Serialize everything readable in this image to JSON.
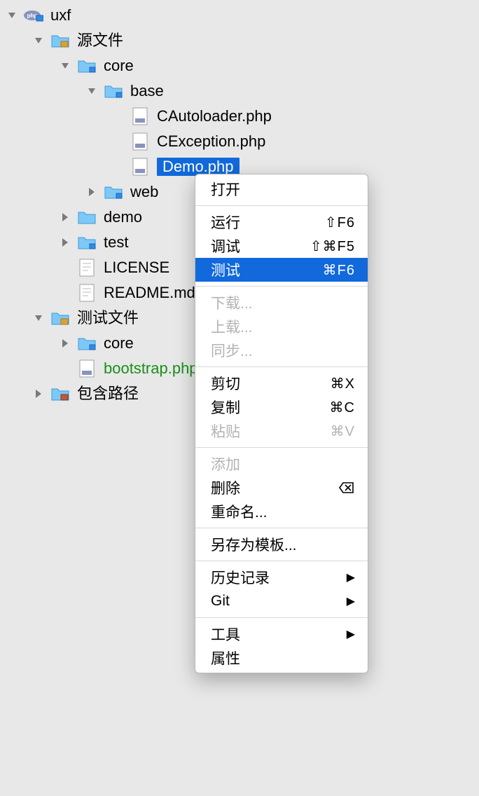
{
  "tree": {
    "root": {
      "label": "uxf"
    },
    "sources": {
      "label": "源文件"
    },
    "core": {
      "label": "core"
    },
    "base": {
      "label": "base"
    },
    "f_autoloader": {
      "label": "CAutoloader.php"
    },
    "f_exception": {
      "label": "CException.php"
    },
    "f_demo": {
      "label": "Demo.php"
    },
    "web": {
      "label": "web"
    },
    "demo": {
      "label": "demo"
    },
    "test": {
      "label": "test"
    },
    "license": {
      "label": "LICENSE"
    },
    "readme": {
      "label": "README.md"
    },
    "testfiles": {
      "label": "测试文件"
    },
    "core2": {
      "label": "core"
    },
    "bootstrap": {
      "label": "bootstrap.php"
    },
    "includepath": {
      "label": "包含路径"
    }
  },
  "menu": {
    "open": "打开",
    "run": "运行",
    "run_sc": "⇧F6",
    "debug": "调试",
    "debug_sc": "⇧⌘F5",
    "test": "测试",
    "test_sc": "⌘F6",
    "download": "下载...",
    "upload": "上载...",
    "sync": "同步...",
    "cut": "剪切",
    "cut_sc": "⌘X",
    "copy": "复制",
    "copy_sc": "⌘C",
    "paste": "粘贴",
    "paste_sc": "⌘V",
    "add": "添加",
    "delete": "删除",
    "rename": "重命名...",
    "saveas": "另存为模板...",
    "history": "历史记录",
    "git": "Git",
    "tools": "工具",
    "properties": "属性"
  }
}
